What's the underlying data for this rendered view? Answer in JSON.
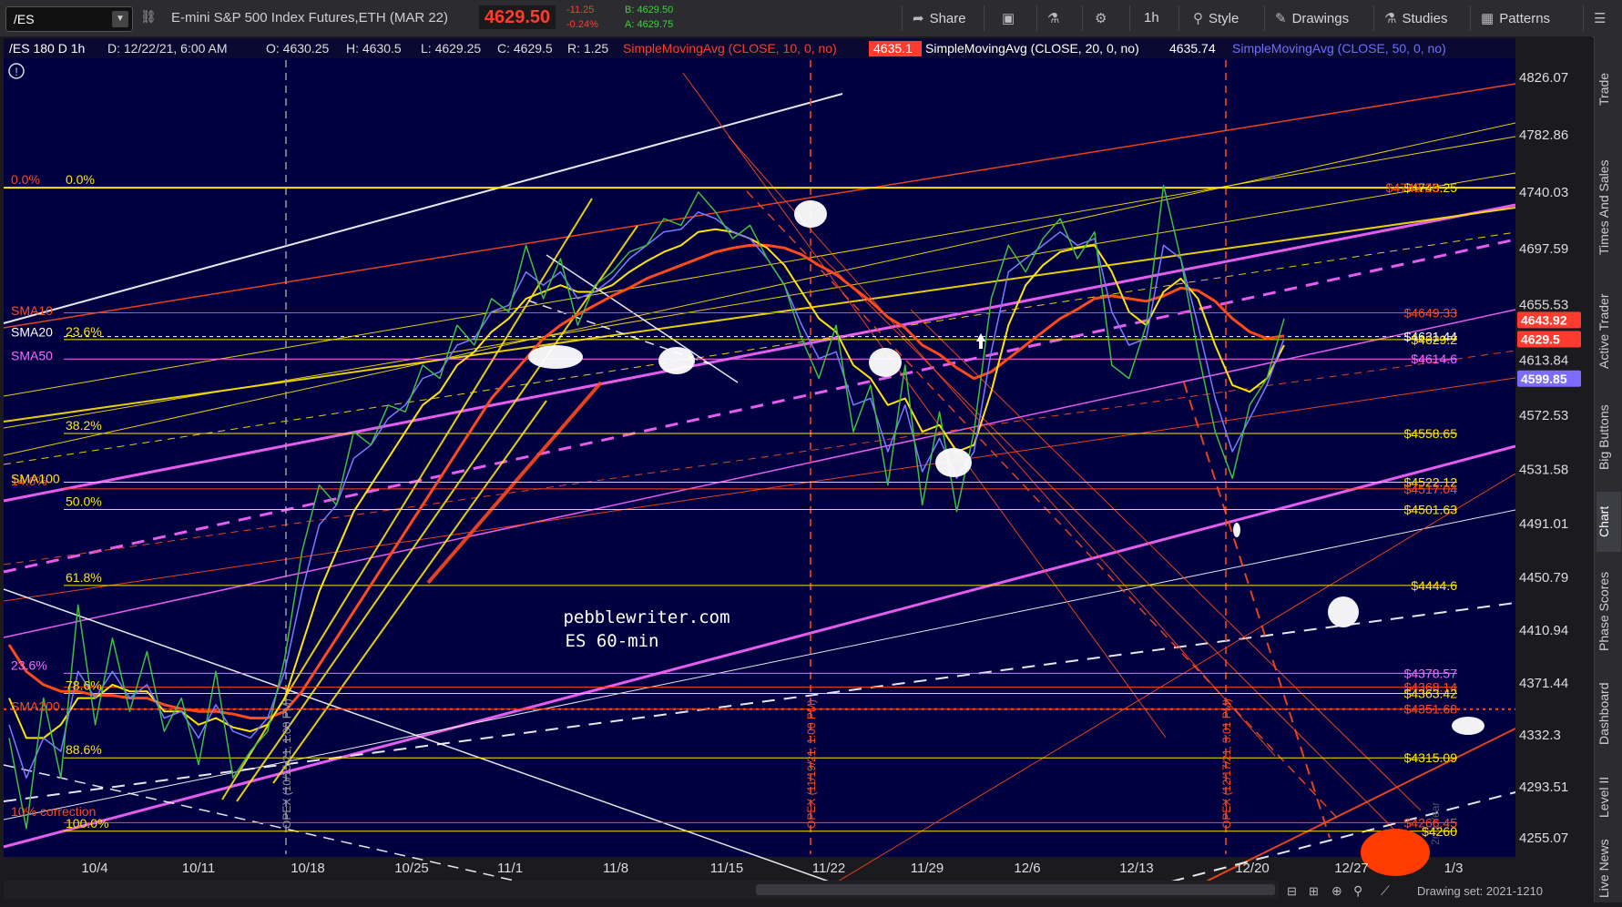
{
  "toolbar": {
    "symbol": "/ES",
    "instrument": "E-mini S&P 500 Index Futures,ETH (MAR 22)",
    "last": "4629.50",
    "change": "-11.25",
    "change_pct": "-0.24%",
    "bid": "B: 4629.50",
    "ask": "A: 4629.75",
    "share": "Share",
    "timeframe": "1h",
    "style": "Style",
    "drawings": "Drawings",
    "studies": "Studies",
    "patterns": "Patterns"
  },
  "header": {
    "title": "/ES 180 D 1h",
    "date": "D: 12/22/21, 6:00 AM",
    "open": "O: 4630.25",
    "high": "H: 4630.5",
    "low": "L: 4629.25",
    "close": "C: 4629.5",
    "range": "R: 1.25",
    "sma10_label": "SimpleMovingAvg (CLOSE, 10, 0, no)",
    "sma10_value": "4635.1",
    "sma20_label": "SimpleMovingAvg (CLOSE, 20, 0, no)",
    "sma20_value": "4635.74",
    "sma50_label": "SimpleMovingAvg (CLOSE, 50, 0, no)"
  },
  "sidebar": [
    "Trade",
    "Times And Sales",
    "Active Trader",
    "Big Buttons",
    "Chart",
    "Phase Scores",
    "Dashboard",
    "Level II",
    "Live News"
  ],
  "footer": {
    "drawing_set": "Drawing set: 2021-1210"
  },
  "chart_data": {
    "type": "line",
    "title": "pebblewriter.com",
    "subtitle": "ES 60-min",
    "ylim": [
      4240,
      4845
    ],
    "y_ticks": [
      4826.07,
      4782.86,
      4740.03,
      4697.59,
      4655.53,
      4613.84,
      4572.53,
      4531.58,
      4491.01,
      4450.79,
      4410.94,
      4371.44,
      4332.3,
      4293.51,
      4255.07
    ],
    "x_ticks": [
      "10/4",
      "10/11",
      "10/18",
      "10/25",
      "11/1",
      "11/8",
      "11/15",
      "11/22",
      "11/29",
      "12/6",
      "12/13",
      "12/20",
      "12/27",
      "1/3"
    ],
    "price_path": [
      4330,
      4262,
      4360,
      4300,
      4430,
      4340,
      4405,
      4350,
      4395,
      4335,
      4360,
      4310,
      4380,
      4300,
      4320,
      4335,
      4390,
      4470,
      4520,
      4505,
      4560,
      4550,
      4580,
      4575,
      4610,
      4600,
      4640,
      4625,
      4660,
      4650,
      4700,
      4660,
      4690,
      4640,
      4670,
      4680,
      4695,
      4700,
      4720,
      4715,
      4740,
      4725,
      4705,
      4715,
      4690,
      4670,
      4630,
      4600,
      4640,
      4560,
      4595,
      4520,
      4610,
      4505,
      4575,
      4500,
      4560,
      4660,
      4700,
      4680,
      4705,
      4720,
      4690,
      4710,
      4610,
      4600,
      4640,
      4745,
      4690,
      4620,
      4560,
      4525,
      4580,
      4600,
      4645
    ],
    "sma10_path": [
      4340,
      4300,
      4330,
      4320,
      4380,
      4360,
      4380,
      4360,
      4370,
      4345,
      4350,
      4330,
      4355,
      4335,
      4330,
      4345,
      4380,
      4440,
      4490,
      4505,
      4540,
      4550,
      4570,
      4580,
      4600,
      4605,
      4625,
      4630,
      4650,
      4655,
      4680,
      4670,
      4680,
      4660,
      4665,
      4675,
      4690,
      4700,
      4710,
      4712,
      4725,
      4720,
      4710,
      4705,
      4690,
      4670,
      4640,
      4615,
      4620,
      4580,
      4585,
      4545,
      4580,
      4530,
      4555,
      4525,
      4545,
      4620,
      4680,
      4690,
      4700,
      4710,
      4700,
      4705,
      4650,
      4625,
      4630,
      4700,
      4690,
      4640,
      4585,
      4545,
      4570,
      4595,
      4630
    ],
    "sma20_path": [
      4360,
      4330,
      4330,
      4340,
      4360,
      4360,
      4370,
      4365,
      4365,
      4350,
      4350,
      4340,
      4345,
      4338,
      4335,
      4340,
      4360,
      4400,
      4440,
      4470,
      4500,
      4520,
      4540,
      4560,
      4580,
      4590,
      4610,
      4620,
      4635,
      4645,
      4660,
      4665,
      4670,
      4665,
      4665,
      4670,
      4680,
      4688,
      4695,
      4700,
      4710,
      4712,
      4710,
      4705,
      4698,
      4685,
      4665,
      4645,
      4635,
      4610,
      4600,
      4580,
      4585,
      4560,
      4565,
      4545,
      4550,
      4590,
      4640,
      4670,
      4685,
      4695,
      4698,
      4700,
      4680,
      4650,
      4640,
      4665,
      4675,
      4660,
      4625,
      4595,
      4590,
      4600,
      4625
    ],
    "sma50_path": [
      4400,
      4380,
      4370,
      4365,
      4365,
      4362,
      4362,
      4360,
      4360,
      4355,
      4352,
      4350,
      4350,
      4348,
      4345,
      4345,
      4350,
      4365,
      4385,
      4405,
      4425,
      4445,
      4465,
      4485,
      4505,
      4525,
      4545,
      4565,
      4585,
      4600,
      4615,
      4630,
      4640,
      4648,
      4655,
      4662,
      4668,
      4675,
      4680,
      4685,
      4690,
      4695,
      4698,
      4700,
      4700,
      4698,
      4693,
      4685,
      4678,
      4668,
      4658,
      4646,
      4638,
      4625,
      4618,
      4608,
      4600,
      4605,
      4615,
      4625,
      4635,
      4645,
      4652,
      4660,
      4662,
      4660,
      4658,
      4662,
      4668,
      4666,
      4658,
      4645,
      4635,
      4630,
      4632
    ],
    "right_labels": [
      {
        "text": "$4743.25",
        "value": 4743.25,
        "color": "#ffe600"
      },
      {
        "text": "$4743.25",
        "value": 4743.25,
        "color": "#ff4a1c"
      },
      {
        "text": "$4649.33",
        "value": 4649.33,
        "color": "#ff4a1c"
      },
      {
        "text": "$4631.44",
        "value": 4631.44,
        "color": "#ffffff"
      },
      {
        "text": "$4629.2",
        "value": 4629.2,
        "color": "#ffe600"
      },
      {
        "text": "$4614.6",
        "value": 4614.6,
        "color": "#ff66ff"
      },
      {
        "text": "$4558.65",
        "value": 4558.65,
        "color": "#ffe600"
      },
      {
        "text": "$4522.12",
        "value": 4522.12,
        "color": "#ffe600"
      },
      {
        "text": "$4517.04",
        "value": 4517.04,
        "color": "#ff4a1c"
      },
      {
        "text": "$4501.63",
        "value": 4501.63,
        "color": "#ffe600"
      },
      {
        "text": "$4444.6",
        "value": 4444.6,
        "color": "#ffe600"
      },
      {
        "text": "$4378.57",
        "value": 4378.57,
        "color": "#ff66ff"
      },
      {
        "text": "$4368.14",
        "value": 4368.14,
        "color": "#ff4a1c"
      },
      {
        "text": "$4363.42",
        "value": 4363.42,
        "color": "#ffe600"
      },
      {
        "text": "$4351.68",
        "value": 4351.68,
        "color": "#ff4a1c"
      },
      {
        "text": "$4315.09",
        "value": 4315.09,
        "color": "#ffe600"
      },
      {
        "text": "$4266.45",
        "value": 4266.45,
        "color": "#ff4a1c"
      },
      {
        "text": "$4260",
        "value": 4260,
        "color": "#ffe600"
      }
    ],
    "axis_badges": [
      {
        "text": "4643.92",
        "value": 4643.92,
        "color": "#ff3b2f"
      },
      {
        "text": "4629.5",
        "value": 4629.5,
        "color": "#ff3b2f"
      },
      {
        "text": "4599.85",
        "value": 4599.85,
        "color": "#7b6cff"
      }
    ],
    "fib_labels": [
      {
        "text": "0.0%",
        "value": 4743.25,
        "color": "#ff4a1c"
      },
      {
        "text": "0.0%",
        "value": 4743.25,
        "color": "#ffe600"
      },
      {
        "text": "23.6%",
        "value": 4629.2,
        "color": "#ffe600"
      },
      {
        "text": "38.2%",
        "value": 4558.65,
        "color": "#ffe600"
      },
      {
        "text": "14.6%",
        "value": 4517.04,
        "color": "#ff4a1c"
      },
      {
        "text": "50.0%",
        "value": 4501.63,
        "color": "#ffe600"
      },
      {
        "text": "61.8%",
        "value": 4444.6,
        "color": "#ffe600"
      },
      {
        "text": "23.6%",
        "value": 4378.57,
        "color": "#ff66ff"
      },
      {
        "text": "78.6%",
        "value": 4363.42,
        "color": "#ffe600"
      },
      {
        "text": "88.6%",
        "value": 4315.09,
        "color": "#ffe600"
      },
      {
        "text": "100.0%",
        "value": 4260,
        "color": "#ffe600"
      }
    ],
    "left_labels": [
      {
        "text": "SMA10",
        "value": 4651,
        "color": "#ff4a1c"
      },
      {
        "text": "SMA20",
        "value": 4635,
        "color": "#ffffff"
      },
      {
        "text": "SMA50",
        "value": 4617,
        "color": "#ff66ff"
      },
      {
        "text": "SMA100",
        "value": 4525,
        "color": "#ffe600"
      },
      {
        "text": "SMA200",
        "value": 4354,
        "color": "#ff4a1c"
      },
      {
        "text": "10% correction",
        "value": 4275,
        "color": "#ff4a1c"
      }
    ],
    "opex_labels": [
      "OPEX (10/15/21, 1:00 PM)",
      "OPEX (11/19/21, 1:00 PM)",
      "OPEX (12/17/21, 3:01 PM)"
    ],
    "extra_label": "2nd Year"
  }
}
